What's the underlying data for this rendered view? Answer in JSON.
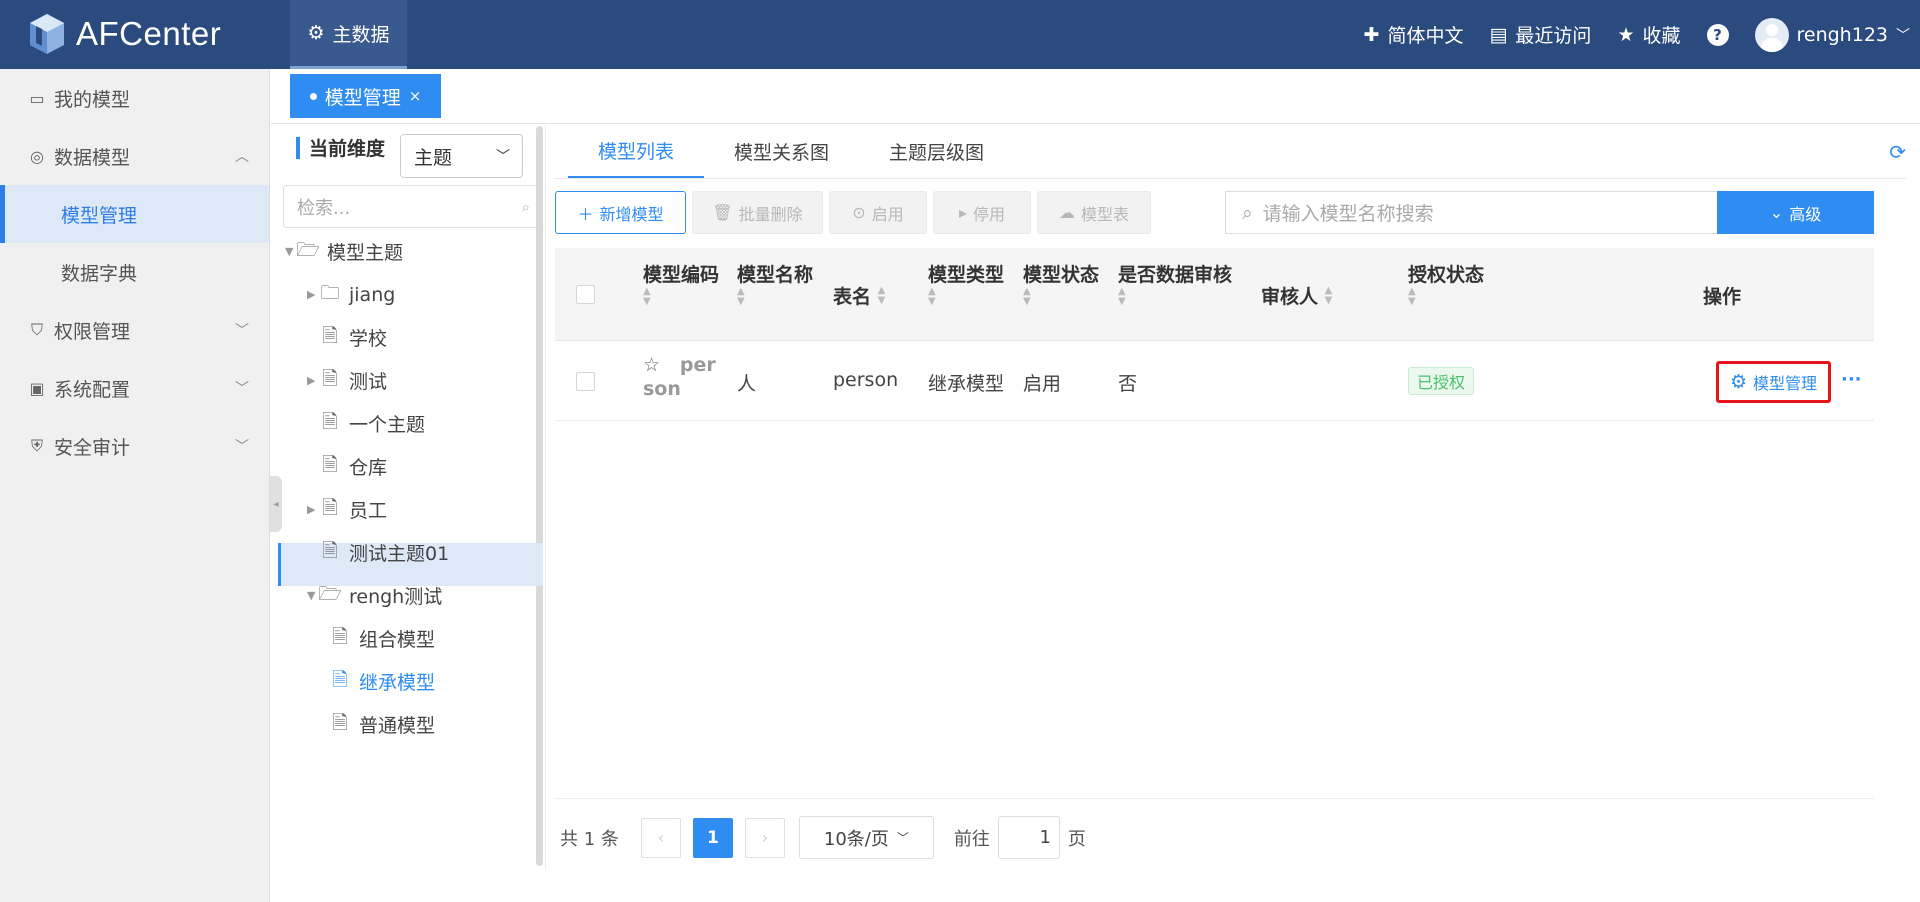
{
  "app": {
    "name": "AFCenter",
    "main_nav": "主数据"
  },
  "top_right": {
    "language": "简体中文",
    "recent": "最近访问",
    "favorites": "收藏",
    "help": "?",
    "user": "rengh123"
  },
  "sidebar": {
    "items": [
      {
        "label": "我的模型",
        "icon": "wallet-icon"
      },
      {
        "label": "数据模型",
        "icon": "database-icon",
        "expanded": true,
        "children": [
          {
            "label": "模型管理",
            "active": true
          },
          {
            "label": "数据字典",
            "active": false
          }
        ]
      },
      {
        "label": "权限管理",
        "icon": "shield-icon"
      },
      {
        "label": "系统配置",
        "icon": "chip-icon"
      },
      {
        "label": "安全审计",
        "icon": "security-icon"
      }
    ]
  },
  "page_tab": {
    "label": "模型管理",
    "close": "×"
  },
  "tree_panel": {
    "dimension_label": "当前维度",
    "dimension_value": "主题",
    "search_placeholder": "检索...",
    "nodes": [
      {
        "label": "模型主题",
        "type": "folder",
        "level": 0,
        "expanded": true
      },
      {
        "label": "jiang",
        "type": "folder",
        "level": 1,
        "expandable": true
      },
      {
        "label": "学校",
        "type": "doc",
        "level": 1
      },
      {
        "label": "测试",
        "type": "doc",
        "level": 1,
        "expandable": true
      },
      {
        "label": "一个主题",
        "type": "doc",
        "level": 1
      },
      {
        "label": "仓库",
        "type": "doc",
        "level": 1
      },
      {
        "label": "员工",
        "type": "doc",
        "level": 1,
        "expandable": true
      },
      {
        "label": "测试主题01",
        "type": "doc",
        "level": 1
      },
      {
        "label": "rengh测试",
        "type": "folder",
        "level": 1,
        "expanded": true
      },
      {
        "label": "组合模型",
        "type": "doc",
        "level": 2
      },
      {
        "label": "继承模型",
        "type": "doc",
        "level": 2,
        "selected": true
      },
      {
        "label": "普通模型",
        "type": "doc",
        "level": 2
      }
    ]
  },
  "main": {
    "tabs": [
      {
        "label": "模型列表",
        "active": true
      },
      {
        "label": "模型关系图",
        "active": false
      },
      {
        "label": "主题层级图",
        "active": false
      }
    ],
    "toolbar": {
      "add": "新增模型",
      "batch_delete": "批量删除",
      "enable": "启用",
      "disable": "停用",
      "model_table": "模型表"
    },
    "search_placeholder": "请输入模型名称搜索",
    "advanced": "高级",
    "columns": [
      "模型编码",
      "模型名称",
      "表名",
      "模型类型",
      "模型状态",
      "是否数据审核",
      "审核人",
      "授权状态",
      "操作"
    ],
    "rows": [
      {
        "code_line1": "per",
        "code_line2": "son",
        "name": "人",
        "table": "person",
        "type": "继承模型",
        "status": "启用",
        "audit": "否",
        "auditor": "",
        "auth": "已授权",
        "action": "模型管理",
        "more": "···"
      }
    ],
    "pager": {
      "total": "共 1 条",
      "current": "1",
      "size": "10条/页",
      "goto_label": "前往",
      "goto_value": "1",
      "page_suffix": "页"
    }
  },
  "colors": {
    "topbar": "#2b4a7d",
    "accent": "#2f8cf0",
    "highlight_border": "#e8121b",
    "auth_green": "#4cbf6a"
  }
}
